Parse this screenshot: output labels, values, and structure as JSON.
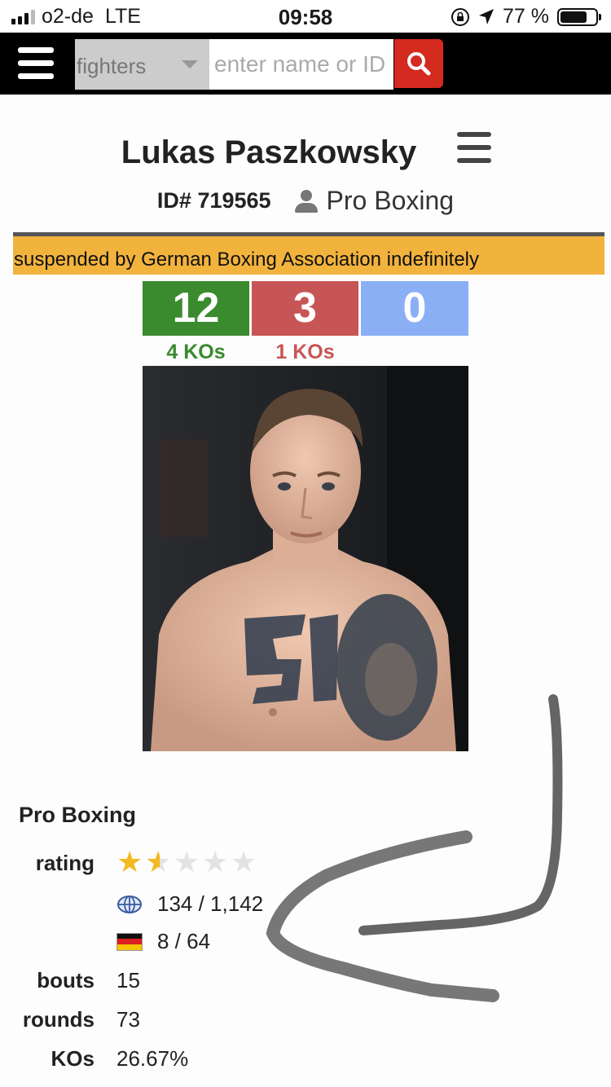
{
  "status_bar": {
    "carrier": "o2-de",
    "network": "LTE",
    "time": "09:58",
    "battery": "77 %",
    "battery_level": 0.77,
    "icons": [
      "signal-icon",
      "orientation-lock-icon",
      "location-arrow-icon",
      "battery-icon"
    ]
  },
  "nav": {
    "category": "fighters",
    "search_placeholder": "enter name or ID",
    "search_icon": "search-icon",
    "accent_color": "#d42a1f"
  },
  "fighter": {
    "name": "Lukas Paszkowsky",
    "id": "ID# 719565",
    "sport": "Pro Boxing",
    "alert": "suspended by German Boxing Association indefinitely",
    "record": {
      "wins": "12",
      "losses": "3",
      "draws": "0",
      "win_kos": "4 KOs",
      "loss_kos": "1 KOs",
      "colors": {
        "win": "#3a8a2e",
        "loss": "#c85555",
        "draw": "#8aaff5"
      }
    }
  },
  "stats": {
    "section_title": "Pro Boxing",
    "rating_label": "rating",
    "rating_stars": 1.5,
    "rating_max": 5,
    "world_rank": "134 / 1,142",
    "country_rank": "8 / 64",
    "bouts_label": "bouts",
    "bouts": "15",
    "rounds_label": "rounds",
    "rounds": "73",
    "kos_label": "KOs",
    "kos": "26.67%"
  }
}
